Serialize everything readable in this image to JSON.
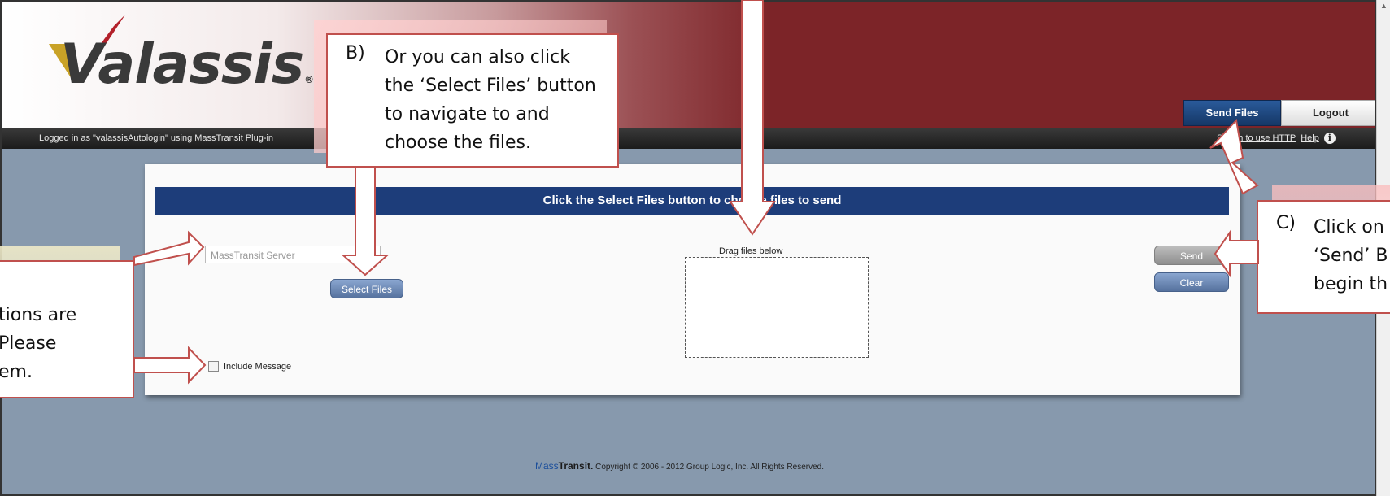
{
  "app": {
    "logo_text": "Valassis",
    "logo_reg": "®"
  },
  "header": {
    "tabs": [
      {
        "label": "Send Files",
        "active": true
      },
      {
        "label": "Logout",
        "active": false
      }
    ]
  },
  "status_bar": {
    "logged_in_text": "Logged in as \"valassisAutologin\" using MassTransit Plug-in",
    "switch_link": "Switch to use HTTP",
    "help_link": "Help",
    "info_icon": "info-icon"
  },
  "panel": {
    "title": "Click the Select Files button to choose files to send",
    "server_select": {
      "value": "MassTransit Server"
    },
    "select_files_label": "Select Files",
    "include_message_label": "Include Message",
    "drag_label": "Drag files below",
    "send_label": "Send",
    "clear_label": "Clear"
  },
  "footer": {
    "brand_prefix": "Mass",
    "brand_suffix": "Transit.",
    "copyright": "Copyright © 2006 - 2012 Group Logic, Inc. All Rights Reserved."
  },
  "callouts": {
    "b": {
      "letter": "B)",
      "text": "Or you can also click the ‘Select Files’ button to navigate to and choose the files."
    },
    "c": {
      "letter": "C)",
      "line1": "Click on",
      "line2": "‘Send’ B",
      "line3": "begin th"
    },
    "a": {
      "line1": "tions are",
      "line2": " Please",
      "line3": "em."
    }
  },
  "colors": {
    "header_red": "#7c2428",
    "panel_title_blue": "#1d3d7a",
    "callout_border": "#c0504d",
    "page_background": "#8799ad"
  }
}
